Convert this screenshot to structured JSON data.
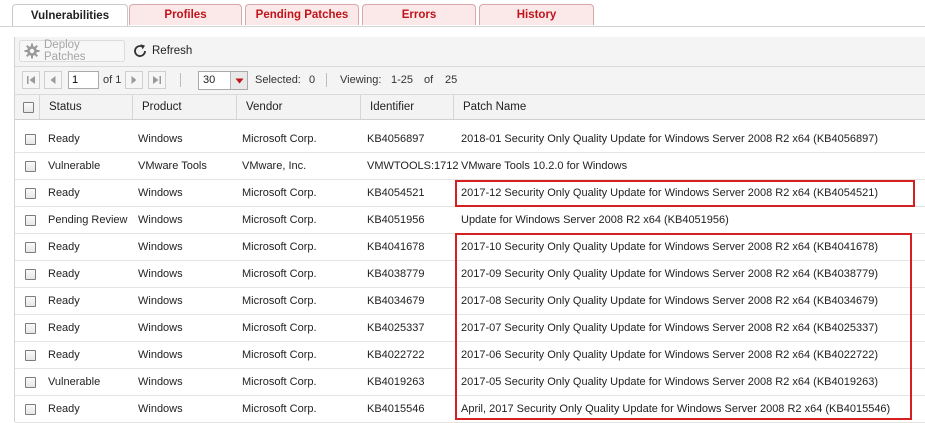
{
  "tabs": [
    {
      "label": "Vulnerabilities",
      "active": true
    },
    {
      "label": "Profiles",
      "active": false
    },
    {
      "label": "Pending Patches",
      "active": false
    },
    {
      "label": "Errors",
      "active": false
    },
    {
      "label": "History",
      "active": false
    }
  ],
  "toolbar": {
    "deploy_label": "Deploy Patches",
    "deploy_icon": "gear-icon",
    "refresh_label": "Refresh",
    "refresh_icon": "refresh-icon"
  },
  "pager": {
    "page_value": "1",
    "of_label": "of 1",
    "page_size": "30",
    "selected_label": "Selected:",
    "selected_count": "0",
    "viewing_label": "Viewing:",
    "viewing_range": "1-25",
    "of_word": "of",
    "total": "25"
  },
  "columns": [
    "Status",
    "Product",
    "Vendor",
    "Identifier",
    "Patch Name"
  ],
  "rows": [
    {
      "status": "Ready",
      "product": "Windows",
      "vendor": "Microsoft Corp.",
      "identifier": "KB4056897",
      "patch": "2018-01 Security Only Quality Update for Windows Server 2008 R2 x64 (KB4056897)"
    },
    {
      "status": "Vulnerable",
      "product": "VMware Tools",
      "vendor": "VMware, Inc.",
      "identifier": "VMWTOOLS:1712",
      "patch": "VMware Tools 10.2.0 for Windows"
    },
    {
      "status": "Ready",
      "product": "Windows",
      "vendor": "Microsoft Corp.",
      "identifier": "KB4054521",
      "patch": "2017-12 Security Only Quality Update for Windows Server 2008 R2 x64 (KB4054521)"
    },
    {
      "status": "Pending Review",
      "product": "Windows",
      "vendor": "Microsoft Corp.",
      "identifier": "KB4051956",
      "patch": "Update for Windows Server 2008 R2 x64 (KB4051956)"
    },
    {
      "status": "Ready",
      "product": "Windows",
      "vendor": "Microsoft Corp.",
      "identifier": "KB4041678",
      "patch": "2017-10 Security Only Quality Update for Windows Server 2008 R2 x64 (KB4041678)"
    },
    {
      "status": "Ready",
      "product": "Windows",
      "vendor": "Microsoft Corp.",
      "identifier": "KB4038779",
      "patch": "2017-09 Security Only Quality Update for Windows Server 2008 R2 x64 (KB4038779)"
    },
    {
      "status": "Ready",
      "product": "Windows",
      "vendor": "Microsoft Corp.",
      "identifier": "KB4034679",
      "patch": "2017-08 Security Only Quality Update for Windows Server 2008 R2 x64 (KB4034679)"
    },
    {
      "status": "Ready",
      "product": "Windows",
      "vendor": "Microsoft Corp.",
      "identifier": "KB4025337",
      "patch": "2017-07 Security Only Quality Update for Windows Server 2008 R2 x64 (KB4025337)"
    },
    {
      "status": "Ready",
      "product": "Windows",
      "vendor": "Microsoft Corp.",
      "identifier": "KB4022722",
      "patch": "2017-06 Security Only Quality Update for Windows Server 2008 R2 x64 (KB4022722)"
    },
    {
      "status": "Vulnerable",
      "product": "Windows",
      "vendor": "Microsoft Corp.",
      "identifier": "KB4019263",
      "patch": "2017-05 Security Only Quality Update for Windows Server 2008 R2 x64 (KB4019263)"
    },
    {
      "status": "Ready",
      "product": "Windows",
      "vendor": "Microsoft Corp.",
      "identifier": "KB4015546",
      "patch": "April, 2017 Security Only Quality Update for Windows Server 2008 R2 x64 (KB4015546)"
    }
  ],
  "colors": {
    "tab_accent": "#c0141b",
    "highlight": "#d42020"
  }
}
